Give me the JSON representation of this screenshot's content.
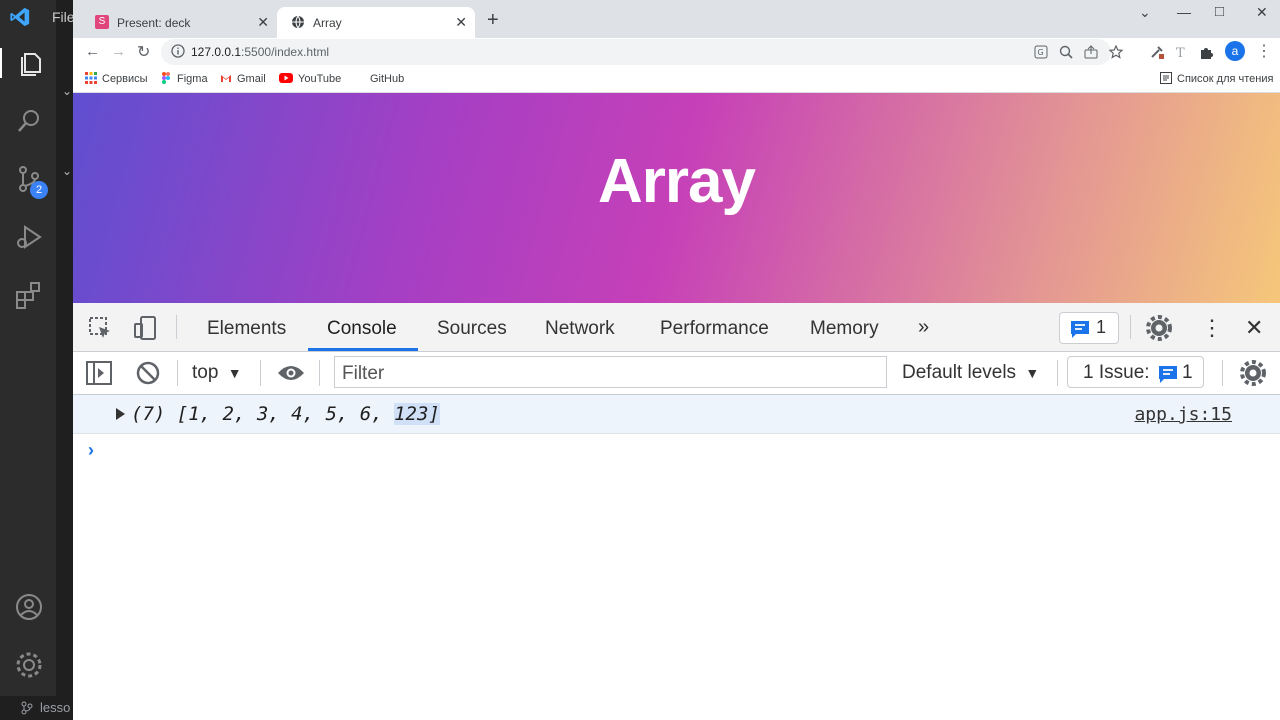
{
  "vscode": {
    "menu_file": "File",
    "scm_badge": "2",
    "status_branch": "lesso"
  },
  "browser": {
    "tabs": [
      {
        "title": "Present: deck",
        "favicon": "slides-icon"
      },
      {
        "title": "Array",
        "favicon": "globe-icon",
        "active": true
      }
    ],
    "url": "127.0.0.1",
    "url_rest": ":5500/index.html",
    "avatar_letter": "a",
    "bookmarks": [
      {
        "label": "Сервисы",
        "icon": "apps-grid-icon"
      },
      {
        "label": "Figma",
        "icon": "figma-icon"
      },
      {
        "label": "Gmail",
        "icon": "gmail-icon"
      },
      {
        "label": "YouTube",
        "icon": "youtube-icon"
      },
      {
        "label": "GitHub",
        "icon": "github-icon"
      }
    ],
    "reading_list": "Список для чтения"
  },
  "page": {
    "heading": "Array",
    "gradient_colors": [
      "#5f4fd0",
      "#c640b8",
      "#f5c77a"
    ]
  },
  "devtools": {
    "tabs": [
      "Elements",
      "Console",
      "Sources",
      "Network",
      "Performance",
      "Memory"
    ],
    "active_tab": "Console",
    "message_count": "1",
    "context": "top",
    "filter_placeholder": "Filter",
    "levels": "Default levels",
    "issues_label": "1 Issue:",
    "issues_count": "1",
    "log": {
      "prefix": "(7) [1, 2, 3, 4, 5, 6, ",
      "highlight": "123]",
      "source": "app.js:15"
    },
    "accent": "#1a73e8"
  }
}
